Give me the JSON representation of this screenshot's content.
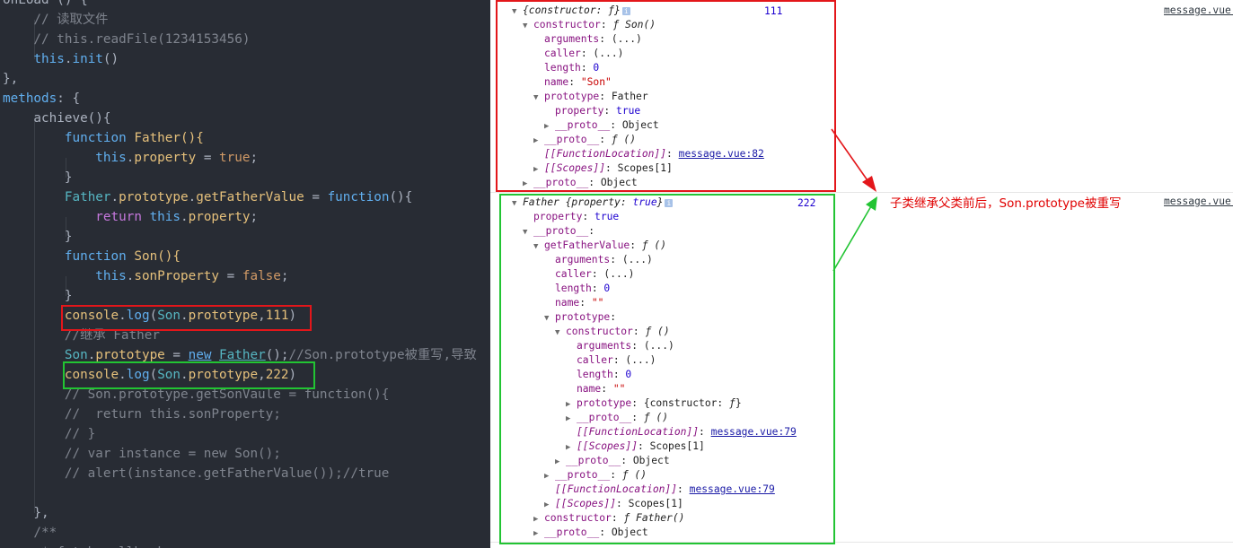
{
  "editor": {
    "lines": [
      [
        {
          "t": "onLoad () {",
          "c": "tok-plain"
        }
      ],
      [
        {
          "t": "    // 读取文件",
          "c": "tok-comment"
        }
      ],
      [
        {
          "t": "    // this.readFile(1234153456)",
          "c": "tok-comment"
        }
      ],
      [
        {
          "t": "    ",
          "c": "tok-plain"
        },
        {
          "t": "this",
          "c": "tok-kw"
        },
        {
          "t": ".",
          "c": "tok-plain"
        },
        {
          "t": "init",
          "c": "tok-method"
        },
        {
          "t": "()",
          "c": "tok-plain"
        }
      ],
      [
        {
          "t": "},",
          "c": "tok-plain"
        }
      ],
      [
        {
          "t": "methods",
          "c": "tok-method"
        },
        {
          "t": ": {",
          "c": "tok-plain"
        }
      ],
      [
        {
          "t": "    achieve(){",
          "c": "tok-plain"
        }
      ],
      [
        {
          "t": "        ",
          "c": "tok-plain"
        },
        {
          "t": "function",
          "c": "tok-kw"
        },
        {
          "t": " Father(){",
          "c": "tok-prop"
        }
      ],
      [
        {
          "t": "            ",
          "c": "tok-plain"
        },
        {
          "t": "this",
          "c": "tok-kw"
        },
        {
          "t": ".",
          "c": "tok-plain"
        },
        {
          "t": "property",
          "c": "tok-prop"
        },
        {
          "t": " = ",
          "c": "tok-plain"
        },
        {
          "t": "true",
          "c": "tok-bool"
        },
        {
          "t": ";",
          "c": "tok-plain"
        }
      ],
      [
        {
          "t": "        }",
          "c": "tok-plain"
        }
      ],
      [
        {
          "t": "        ",
          "c": "tok-plain"
        },
        {
          "t": "Father",
          "c": "tok-cls"
        },
        {
          "t": ".",
          "c": "tok-plain"
        },
        {
          "t": "prototype",
          "c": "tok-prop"
        },
        {
          "t": ".",
          "c": "tok-plain"
        },
        {
          "t": "getFatherValue",
          "c": "tok-prop"
        },
        {
          "t": " = ",
          "c": "tok-plain"
        },
        {
          "t": "function",
          "c": "tok-kw"
        },
        {
          "t": "(){",
          "c": "tok-plain"
        }
      ],
      [
        {
          "t": "            ",
          "c": "tok-plain"
        },
        {
          "t": "return",
          "c": "tok-ret"
        },
        {
          "t": " ",
          "c": "tok-plain"
        },
        {
          "t": "this",
          "c": "tok-kw"
        },
        {
          "t": ".",
          "c": "tok-plain"
        },
        {
          "t": "property",
          "c": "tok-prop"
        },
        {
          "t": ";",
          "c": "tok-plain"
        }
      ],
      [
        {
          "t": "        }",
          "c": "tok-plain"
        }
      ],
      [
        {
          "t": "        ",
          "c": "tok-plain"
        },
        {
          "t": "function",
          "c": "tok-kw"
        },
        {
          "t": " Son(){",
          "c": "tok-prop"
        }
      ],
      [
        {
          "t": "            ",
          "c": "tok-plain"
        },
        {
          "t": "this",
          "c": "tok-kw"
        },
        {
          "t": ".",
          "c": "tok-plain"
        },
        {
          "t": "sonProperty",
          "c": "tok-prop"
        },
        {
          "t": " = ",
          "c": "tok-plain"
        },
        {
          "t": "false",
          "c": "tok-bool"
        },
        {
          "t": ";",
          "c": "tok-plain"
        }
      ],
      [
        {
          "t": "        }",
          "c": "tok-plain"
        }
      ],
      [
        {
          "t": "        ",
          "c": "tok-plain"
        },
        {
          "t": "console",
          "c": "tok-prop"
        },
        {
          "t": ".",
          "c": "tok-plain"
        },
        {
          "t": "log",
          "c": "tok-method"
        },
        {
          "t": "(",
          "c": "tok-plain"
        },
        {
          "t": "Son",
          "c": "tok-cls"
        },
        {
          "t": ".",
          "c": "tok-plain"
        },
        {
          "t": "prototype",
          "c": "tok-prop"
        },
        {
          "t": ",",
          "c": "tok-plain"
        },
        {
          "t": "111",
          "c": "tok-prop"
        },
        {
          "t": ")",
          "c": "tok-plain"
        }
      ],
      [
        {
          "t": "        //继承 Father",
          "c": "tok-comment"
        }
      ],
      [
        {
          "t": "        ",
          "c": "tok-plain"
        },
        {
          "t": "Son",
          "c": "tok-cls"
        },
        {
          "t": ".",
          "c": "tok-plain"
        },
        {
          "t": "prototype",
          "c": "tok-prop"
        },
        {
          "t": " = ",
          "c": "tok-plain"
        },
        {
          "t": "new",
          "c": "tok-kw tok-ul"
        },
        {
          "t": " ",
          "c": "tok-plain"
        },
        {
          "t": "Father",
          "c": "tok-cls tok-ul"
        },
        {
          "t": "();",
          "c": "tok-plain"
        },
        {
          "t": "//Son.prototype被重写,导致",
          "c": "tok-comment"
        }
      ],
      [
        {
          "t": "        ",
          "c": "tok-plain"
        },
        {
          "t": "console",
          "c": "tok-prop"
        },
        {
          "t": ".",
          "c": "tok-plain"
        },
        {
          "t": "log",
          "c": "tok-method"
        },
        {
          "t": "(",
          "c": "tok-plain"
        },
        {
          "t": "Son",
          "c": "tok-cls"
        },
        {
          "t": ".",
          "c": "tok-plain"
        },
        {
          "t": "prototype",
          "c": "tok-prop"
        },
        {
          "t": ",",
          "c": "tok-plain"
        },
        {
          "t": "222",
          "c": "tok-prop"
        },
        {
          "t": ")",
          "c": "tok-plain"
        }
      ],
      [
        {
          "t": "        // Son.prototype.getSonVaule = function(){",
          "c": "tok-comment"
        }
      ],
      [
        {
          "t": "        //  return this.sonProperty;",
          "c": "tok-comment"
        }
      ],
      [
        {
          "t": "        // }",
          "c": "tok-comment"
        }
      ],
      [
        {
          "t": "        // var instance = new Son();",
          "c": "tok-comment"
        }
      ],
      [
        {
          "t": "        // alert(instance.getFatherValue());//true",
          "c": "tok-comment"
        }
      ],
      [
        {
          "t": "",
          "c": "tok-plain"
        }
      ],
      [
        {
          "t": "    },",
          "c": "tok-plain"
        }
      ],
      [
        {
          "t": "    /**",
          "c": "tok-comment"
        }
      ],
      [
        {
          "t": "     * fetch callback",
          "c": "tok-comment"
        }
      ]
    ]
  },
  "console": {
    "entry1": {
      "count": "111",
      "source": "message.vue:",
      "rows": [
        {
          "d": 0,
          "tri": "▼",
          "segs": [
            {
              "t": "{constructor: ",
              "c": "ci"
            },
            {
              "t": "ƒ",
              "c": "ci"
            },
            {
              "t": "}",
              "c": "ci"
            }
          ],
          "info": true
        },
        {
          "d": 1,
          "tri": "▼",
          "segs": [
            {
              "t": "constructor",
              "c": "ck"
            },
            {
              "t": ": "
            },
            {
              "t": "ƒ ",
              "c": "ci"
            },
            {
              "t": "Son()",
              "c": "ci"
            }
          ]
        },
        {
          "d": 2,
          "segs": [
            {
              "t": "arguments",
              "c": "ck"
            },
            {
              "t": ": (...)"
            }
          ]
        },
        {
          "d": 2,
          "segs": [
            {
              "t": "caller",
              "c": "ck"
            },
            {
              "t": ": (...)"
            }
          ]
        },
        {
          "d": 2,
          "segs": [
            {
              "t": "length",
              "c": "ck"
            },
            {
              "t": ": "
            },
            {
              "t": "0",
              "c": "cb"
            }
          ]
        },
        {
          "d": 2,
          "segs": [
            {
              "t": "name",
              "c": "ck"
            },
            {
              "t": ": "
            },
            {
              "t": "\"Son\"",
              "c": "cd"
            }
          ]
        },
        {
          "d": 2,
          "tri": "▼",
          "segs": [
            {
              "t": "prototype",
              "c": "ck"
            },
            {
              "t": ": Father"
            }
          ]
        },
        {
          "d": 3,
          "segs": [
            {
              "t": "property",
              "c": "ck"
            },
            {
              "t": ": "
            },
            {
              "t": "true",
              "c": "cb"
            }
          ]
        },
        {
          "d": 3,
          "tri": "▶",
          "segs": [
            {
              "t": "__proto__",
              "c": "ck"
            },
            {
              "t": ": Object"
            }
          ]
        },
        {
          "d": 2,
          "tri": "▶",
          "segs": [
            {
              "t": "__proto__",
              "c": "ck"
            },
            {
              "t": ": "
            },
            {
              "t": "ƒ ()",
              "c": "ci"
            }
          ]
        },
        {
          "d": 2,
          "segs": [
            {
              "t": "[[FunctionLocation]]",
              "c": "ck ci"
            },
            {
              "t": ": "
            },
            {
              "t": "message.vue:82",
              "c": "cu"
            }
          ]
        },
        {
          "d": 2,
          "tri": "▶",
          "segs": [
            {
              "t": "[[Scopes]]",
              "c": "ck ci"
            },
            {
              "t": ": Scopes[1]"
            }
          ]
        },
        {
          "d": 1,
          "tri": "▶",
          "segs": [
            {
              "t": "__proto__",
              "c": "ck"
            },
            {
              "t": ": Object"
            }
          ]
        }
      ]
    },
    "entry2": {
      "count": "222",
      "source": "message.vue:",
      "rows": [
        {
          "d": 0,
          "tri": "▼",
          "segs": [
            {
              "t": "Father ",
              "c": "ci"
            },
            {
              "t": "{property: ",
              "c": "ci"
            },
            {
              "t": "true",
              "c": "ci cb"
            },
            {
              "t": "}",
              "c": "ci"
            }
          ],
          "info": true
        },
        {
          "d": 1,
          "segs": [
            {
              "t": "property",
              "c": "ck"
            },
            {
              "t": ": "
            },
            {
              "t": "true",
              "c": "cb"
            }
          ]
        },
        {
          "d": 1,
          "tri": "▼",
          "segs": [
            {
              "t": "__proto__",
              "c": "ck"
            },
            {
              "t": ":"
            }
          ]
        },
        {
          "d": 2,
          "tri": "▼",
          "segs": [
            {
              "t": "getFatherValue",
              "c": "ck"
            },
            {
              "t": ": "
            },
            {
              "t": "ƒ ()",
              "c": "ci"
            }
          ]
        },
        {
          "d": 3,
          "segs": [
            {
              "t": "arguments",
              "c": "ck"
            },
            {
              "t": ": (...)"
            }
          ]
        },
        {
          "d": 3,
          "segs": [
            {
              "t": "caller",
              "c": "ck"
            },
            {
              "t": ": (...)"
            }
          ]
        },
        {
          "d": 3,
          "segs": [
            {
              "t": "length",
              "c": "ck"
            },
            {
              "t": ": "
            },
            {
              "t": "0",
              "c": "cb"
            }
          ]
        },
        {
          "d": 3,
          "segs": [
            {
              "t": "name",
              "c": "ck"
            },
            {
              "t": ": "
            },
            {
              "t": "\"\"",
              "c": "cd"
            }
          ]
        },
        {
          "d": 3,
          "tri": "▼",
          "segs": [
            {
              "t": "prototype",
              "c": "ck"
            },
            {
              "t": ":"
            }
          ]
        },
        {
          "d": 4,
          "tri": "▼",
          "segs": [
            {
              "t": "constructor",
              "c": "ck"
            },
            {
              "t": ": "
            },
            {
              "t": "ƒ ()",
              "c": "ci"
            }
          ]
        },
        {
          "d": 5,
          "segs": [
            {
              "t": "arguments",
              "c": "ck"
            },
            {
              "t": ": (...)"
            }
          ]
        },
        {
          "d": 5,
          "segs": [
            {
              "t": "caller",
              "c": "ck"
            },
            {
              "t": ": (...)"
            }
          ]
        },
        {
          "d": 5,
          "segs": [
            {
              "t": "length",
              "c": "ck"
            },
            {
              "t": ": "
            },
            {
              "t": "0",
              "c": "cb"
            }
          ]
        },
        {
          "d": 5,
          "segs": [
            {
              "t": "name",
              "c": "ck"
            },
            {
              "t": ": "
            },
            {
              "t": "\"\"",
              "c": "cd"
            }
          ]
        },
        {
          "d": 5,
          "tri": "▶",
          "segs": [
            {
              "t": "prototype",
              "c": "ck"
            },
            {
              "t": ": {constructor: "
            },
            {
              "t": "ƒ",
              "c": "ci"
            },
            {
              "t": "}"
            }
          ]
        },
        {
          "d": 5,
          "tri": "▶",
          "segs": [
            {
              "t": "__proto__",
              "c": "ck"
            },
            {
              "t": ": "
            },
            {
              "t": "ƒ ()",
              "c": "ci"
            }
          ]
        },
        {
          "d": 5,
          "segs": [
            {
              "t": "[[FunctionLocation]]",
              "c": "ck ci"
            },
            {
              "t": ": "
            },
            {
              "t": "message.vue:79",
              "c": "cu"
            }
          ]
        },
        {
          "d": 5,
          "tri": "▶",
          "segs": [
            {
              "t": "[[Scopes]]",
              "c": "ck ci"
            },
            {
              "t": ": Scopes[1]"
            }
          ]
        },
        {
          "d": 4,
          "tri": "▶",
          "segs": [
            {
              "t": "__proto__",
              "c": "ck"
            },
            {
              "t": ": Object"
            }
          ]
        },
        {
          "d": 3,
          "tri": "▶",
          "segs": [
            {
              "t": "__proto__",
              "c": "ck"
            },
            {
              "t": ": "
            },
            {
              "t": "ƒ ()",
              "c": "ci"
            }
          ]
        },
        {
          "d": 3,
          "segs": [
            {
              "t": "[[FunctionLocation]]",
              "c": "ck ci"
            },
            {
              "t": ": "
            },
            {
              "t": "message.vue:79",
              "c": "cu"
            }
          ]
        },
        {
          "d": 3,
          "tri": "▶",
          "segs": [
            {
              "t": "[[Scopes]]",
              "c": "ck ci"
            },
            {
              "t": ": Scopes[1]"
            }
          ]
        },
        {
          "d": 2,
          "tri": "▶",
          "segs": [
            {
              "t": "constructor",
              "c": "ck"
            },
            {
              "t": ": "
            },
            {
              "t": "ƒ ",
              "c": "ci"
            },
            {
              "t": "Father()",
              "c": "ci"
            }
          ]
        },
        {
          "d": 2,
          "tri": "▶",
          "segs": [
            {
              "t": "__proto__",
              "c": "ck"
            },
            {
              "t": ": Object"
            }
          ]
        }
      ]
    }
  },
  "annotation": {
    "text": "子类继承父类前后，Son.prototype被重写",
    "color_red": "#e3161a",
    "color_green": "#22c433"
  }
}
